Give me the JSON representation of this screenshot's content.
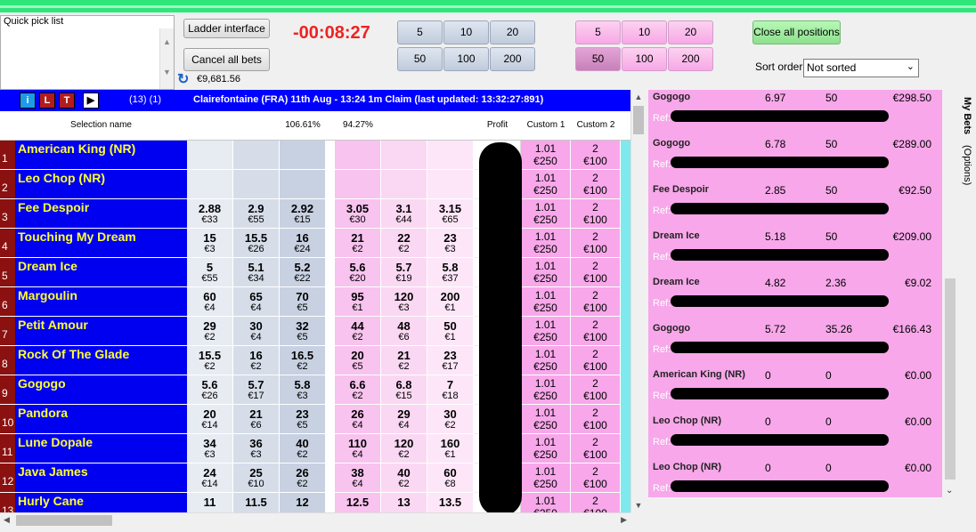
{
  "quick_pick": {
    "label": "Quick pick list"
  },
  "toolbar": {
    "ladder_label": "Ladder interface",
    "cancel_label": "Cancel all bets",
    "timer": "-00:08:27",
    "balance": "€9,681.56",
    "back_stakes": [
      "5",
      "10",
      "20",
      "50",
      "100",
      "200"
    ],
    "lay_stakes": [
      "5",
      "10",
      "20",
      "50",
      "100",
      "200"
    ],
    "lay_selected": "50",
    "close_label": "Close all positions",
    "sort_label": "Sort order",
    "sort_value": "Not sorted"
  },
  "market": {
    "btn_i": "i",
    "btn_l": "L",
    "btn_t": "T",
    "count": "(13) (1)",
    "title": "Clairefontaine (FRA) 11th Aug - 13:24 1m Claim (last updated: 13:32:27:891)"
  },
  "columns": {
    "selection": "Selection name",
    "back_pct": "106.61%",
    "lay_pct": "94.27%",
    "profit": "Profit",
    "custom1": "Custom 1",
    "custom2": "Custom 2"
  },
  "runners": [
    {
      "n": "1",
      "name": "American King (NR)",
      "back": [],
      "lay": []
    },
    {
      "n": "2",
      "name": "Leo Chop (NR)",
      "back": [],
      "lay": []
    },
    {
      "n": "3",
      "name": "Fee Despoir",
      "back": [
        [
          "2.88",
          "€33"
        ],
        [
          "2.9",
          "€55"
        ],
        [
          "2.92",
          "€15"
        ]
      ],
      "lay": [
        [
          "3.05",
          "€30"
        ],
        [
          "3.1",
          "€44"
        ],
        [
          "3.15",
          "€65"
        ]
      ]
    },
    {
      "n": "4",
      "name": "Touching My Dream",
      "back": [
        [
          "15",
          "€3"
        ],
        [
          "15.5",
          "€26"
        ],
        [
          "16",
          "€24"
        ]
      ],
      "lay": [
        [
          "21",
          "€2"
        ],
        [
          "22",
          "€2"
        ],
        [
          "23",
          "€3"
        ]
      ]
    },
    {
      "n": "5",
      "name": "Dream Ice",
      "back": [
        [
          "5",
          "€55"
        ],
        [
          "5.1",
          "€34"
        ],
        [
          "5.2",
          "€22"
        ]
      ],
      "lay": [
        [
          "5.6",
          "€20"
        ],
        [
          "5.7",
          "€19"
        ],
        [
          "5.8",
          "€37"
        ]
      ]
    },
    {
      "n": "6",
      "name": "Margoulin",
      "back": [
        [
          "60",
          "€4"
        ],
        [
          "65",
          "€4"
        ],
        [
          "70",
          "€5"
        ]
      ],
      "lay": [
        [
          "95",
          "€1"
        ],
        [
          "120",
          "€3"
        ],
        [
          "200",
          "€1"
        ]
      ]
    },
    {
      "n": "7",
      "name": "Petit Amour",
      "back": [
        [
          "29",
          "€2"
        ],
        [
          "30",
          "€4"
        ],
        [
          "32",
          "€5"
        ]
      ],
      "lay": [
        [
          "44",
          "€2"
        ],
        [
          "48",
          "€6"
        ],
        [
          "50",
          "€1"
        ]
      ]
    },
    {
      "n": "8",
      "name": "Rock Of The Glade",
      "back": [
        [
          "15.5",
          "€2"
        ],
        [
          "16",
          "€2"
        ],
        [
          "16.5",
          "€2"
        ]
      ],
      "lay": [
        [
          "20",
          "€5"
        ],
        [
          "21",
          "€2"
        ],
        [
          "23",
          "€17"
        ]
      ]
    },
    {
      "n": "9",
      "name": "Gogogo",
      "back": [
        [
          "5.6",
          "€26"
        ],
        [
          "5.7",
          "€17"
        ],
        [
          "5.8",
          "€3"
        ]
      ],
      "lay": [
        [
          "6.6",
          "€2"
        ],
        [
          "6.8",
          "€15"
        ],
        [
          "7",
          "€18"
        ]
      ]
    },
    {
      "n": "10",
      "name": "Pandora",
      "back": [
        [
          "20",
          "€14"
        ],
        [
          "21",
          "€6"
        ],
        [
          "23",
          "€5"
        ]
      ],
      "lay": [
        [
          "26",
          "€4"
        ],
        [
          "29",
          "€4"
        ],
        [
          "30",
          "€2"
        ]
      ]
    },
    {
      "n": "11",
      "name": "Lune Dopale",
      "back": [
        [
          "34",
          "€3"
        ],
        [
          "36",
          "€3"
        ],
        [
          "40",
          "€2"
        ]
      ],
      "lay": [
        [
          "110",
          "€4"
        ],
        [
          "120",
          "€2"
        ],
        [
          "160",
          "€1"
        ]
      ]
    },
    {
      "n": "12",
      "name": "Java James",
      "back": [
        [
          "24",
          "€14"
        ],
        [
          "25",
          "€10"
        ],
        [
          "26",
          "€2"
        ]
      ],
      "lay": [
        [
          "38",
          "€4"
        ],
        [
          "40",
          "€2"
        ],
        [
          "60",
          "€8"
        ]
      ]
    },
    {
      "n": "13",
      "name": "Hurly Cane",
      "back": [
        [
          "11",
          ""
        ],
        [
          "11.5",
          ""
        ],
        [
          "12",
          ""
        ]
      ],
      "lay": [
        [
          "12.5",
          ""
        ],
        [
          "13",
          ""
        ],
        [
          "13.5",
          ""
        ]
      ]
    }
  ],
  "custom": {
    "c1_odds": "1.01",
    "c1_stake": "€250",
    "c2_odds": "2",
    "c2_stake": "€100"
  },
  "bets": [
    {
      "name": "Gogogo",
      "odds": "6.97",
      "stake": "50",
      "profit": "€298.50"
    },
    {
      "name": "Gogogo",
      "odds": "6.78",
      "stake": "50",
      "profit": "€289.00"
    },
    {
      "name": "Fee Despoir",
      "odds": "2.85",
      "stake": "50",
      "profit": "€92.50"
    },
    {
      "name": "Dream Ice",
      "odds": "5.18",
      "stake": "50",
      "profit": "€209.00"
    },
    {
      "name": "Dream Ice",
      "odds": "4.82",
      "stake": "2.36",
      "profit": "€9.02"
    },
    {
      "name": "Gogogo",
      "odds": "5.72",
      "stake": "35.26",
      "profit": "€166.43"
    },
    {
      "name": "American King (NR)",
      "odds": "0",
      "stake": "0",
      "profit": "€0.00"
    },
    {
      "name": "Leo Chop (NR)",
      "odds": "0",
      "stake": "0",
      "profit": "€0.00"
    },
    {
      "name": "Leo Chop (NR)",
      "odds": "0",
      "stake": "0",
      "profit": "€0.00"
    }
  ],
  "ref_label": "Ref:",
  "side_tabs": {
    "my_bets": "My Bets",
    "options": "(Options)"
  },
  "colors": {
    "back": "#c7d1e1",
    "lay": "#f8a7ea",
    "header": "#0000ff",
    "runner_name": "#ffff33",
    "timer": "#ee2222"
  }
}
